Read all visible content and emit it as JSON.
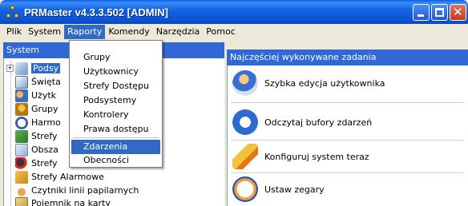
{
  "window": {
    "title": "PRMaster v4.3.3.502 [ADMIN]",
    "controls": {
      "minimize": "minimize",
      "maximize": "maximize",
      "close": "✕"
    }
  },
  "menubar": {
    "items": [
      "Plik",
      "System",
      "Raporty",
      "Komendy",
      "Narzędzia",
      "Pomoc"
    ],
    "active": "Raporty"
  },
  "dropdown": {
    "items": [
      "Grupy",
      "Użytkownicy",
      "Strefy Dostępu",
      "Podsystemy",
      "Kontrolery",
      "Prawa dostępu",
      "Zdarzenia",
      "Obecności"
    ],
    "highlighted": "Zdarzenia"
  },
  "left_panel": {
    "header": "System",
    "tree": [
      {
        "label": "Podsy",
        "icon": "network-icon",
        "selected": true
      },
      {
        "label": "Święta",
        "icon": "calendar-icon"
      },
      {
        "label": "Użytk",
        "icon": "users-icon"
      },
      {
        "label": "Grupy",
        "icon": "group-icon"
      },
      {
        "label": "Harmo",
        "icon": "clock-icon"
      },
      {
        "label": "Strefy",
        "icon": "zone-icon"
      },
      {
        "label": "Obsza",
        "icon": "area-icon"
      },
      {
        "label": "Strefy",
        "icon": "door-icon"
      },
      {
        "label": "Strefy Alarmowe",
        "icon": "alarm-icon"
      },
      {
        "label": "Czytniki linii papilarnych",
        "icon": "fingerprint-icon"
      },
      {
        "label": "Pojemnik na karty",
        "icon": "card-box-icon"
      }
    ]
  },
  "right_panel": {
    "header": "Najczęściej wykonywane zadania",
    "tasks": [
      {
        "label": "Szybka edycja użytkownika",
        "icon": "user-edit-icon"
      },
      {
        "label": "Odczytaj bufory zdarzeń",
        "icon": "refresh-icon"
      },
      {
        "label": "Konfiguruj system teraz",
        "icon": "wand-icon"
      },
      {
        "label": "Ustaw zegary",
        "icon": "clock-icon"
      }
    ]
  },
  "colors": {
    "titlebar": "#0b55d4",
    "highlight": "#316ac5",
    "panel_header": "#3168d5"
  }
}
